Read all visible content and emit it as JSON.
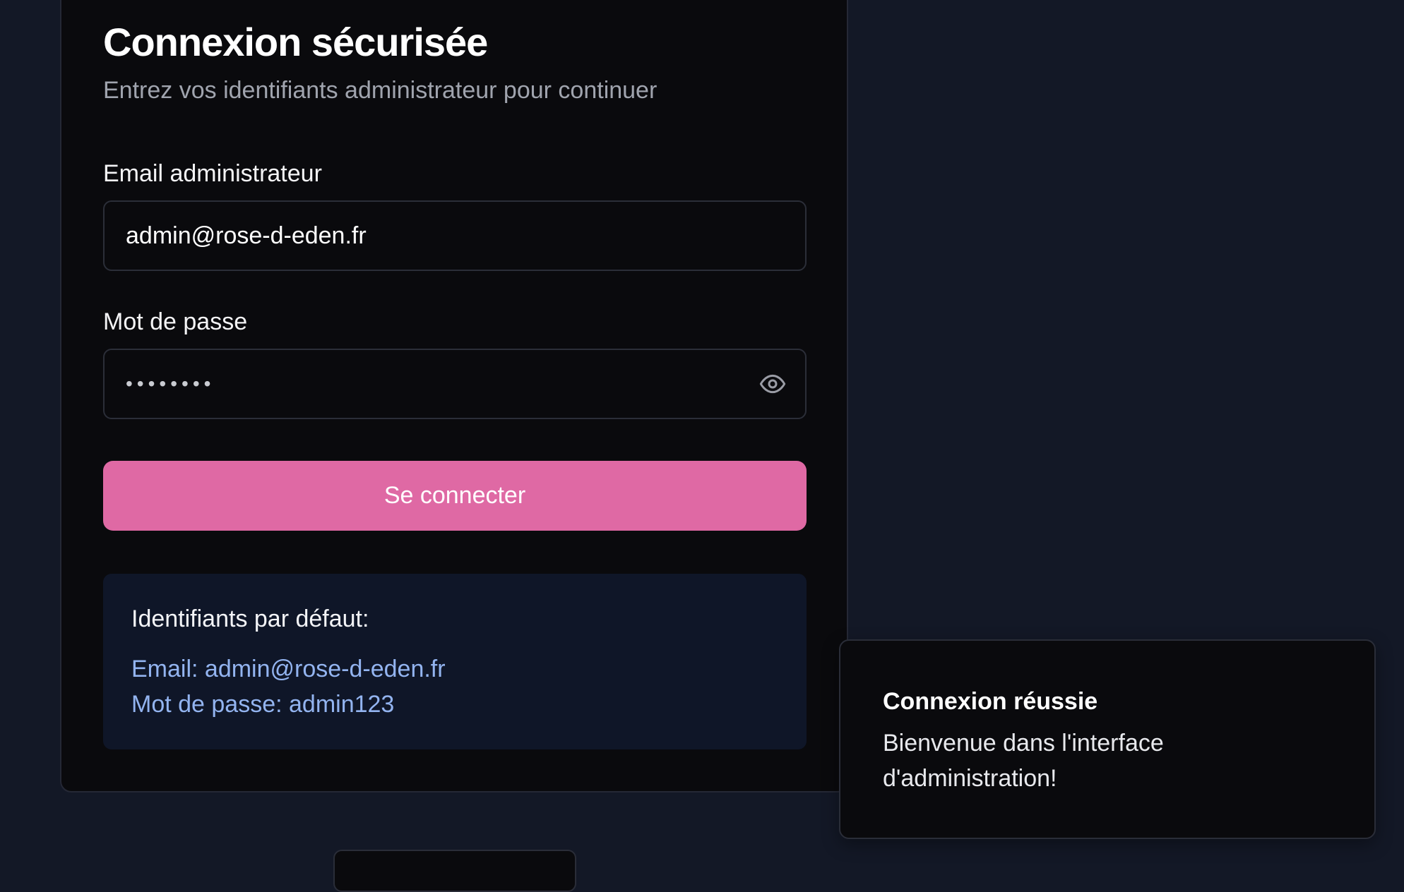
{
  "login": {
    "title": "Connexion sécurisée",
    "subtitle": "Entrez vos identifiants administrateur pour continuer",
    "email_label": "Email administrateur",
    "email_value": "admin@rose-d-eden.fr",
    "password_label": "Mot de passe",
    "password_value": "••••••••",
    "submit_label": "Se connecter"
  },
  "defaults_box": {
    "title": "Identifiants par défaut:",
    "email_line": "Email: admin@rose-d-eden.fr",
    "password_line": "Mot de passe: admin123"
  },
  "toast": {
    "title": "Connexion réussie",
    "message": "Bienvenue dans l'interface d'administration!"
  },
  "icons": {
    "password_toggle": "eye-icon"
  },
  "colors": {
    "page_background": "#131826",
    "card_background": "#0a0a0d",
    "accent": "#df69a4",
    "info_background": "#0f1628",
    "info_text": "#93b4f0"
  }
}
